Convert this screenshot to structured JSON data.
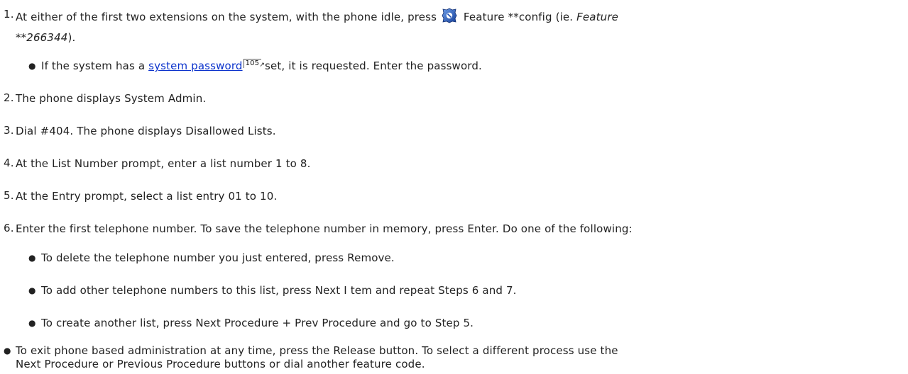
{
  "steps": [
    {
      "num": "1.",
      "pre": "At either of the first two extensions on the system, with the phone idle, press",
      "icon": "feature-button-icon",
      "mid": "Feature **config (ie.",
      "em1": "Feature",
      "em2": "**266344",
      "post": ").",
      "sub": {
        "pre": "If the system has a",
        "link": "system password",
        "pageref": "105",
        "post": "set, it is requested. Enter the password."
      }
    },
    {
      "num": "2.",
      "text": "The phone displays System Admin."
    },
    {
      "num": "3.",
      "text": "Dial #404. The phone displays Disallowed Lists."
    },
    {
      "num": "4.",
      "text": "At the List Number prompt, enter a list number 1 to 8."
    },
    {
      "num": "5.",
      "text": "At the Entry prompt, select a list entry 01 to 10."
    },
    {
      "num": "6.",
      "text": "Enter the first telephone number. To save the telephone number in memory, press Enter.  Do one of the following:",
      "subs": [
        "To delete the telephone number you just entered, press Remove.",
        "To add other telephone numbers to this list, press Next I tem and repeat Steps 6 and 7.",
        "To create another list, press Next Procedure + Prev Procedure and go to Step 5."
      ]
    }
  ],
  "note": {
    "line1": "To exit phone based administration at any time, press the Release button. To select a different process use the",
    "line2": "Next Procedure or Previous Procedure buttons or dial another feature code."
  },
  "colors": {
    "link": "#0b33cc",
    "text": "#222222",
    "icon": "#1f4fb0"
  }
}
